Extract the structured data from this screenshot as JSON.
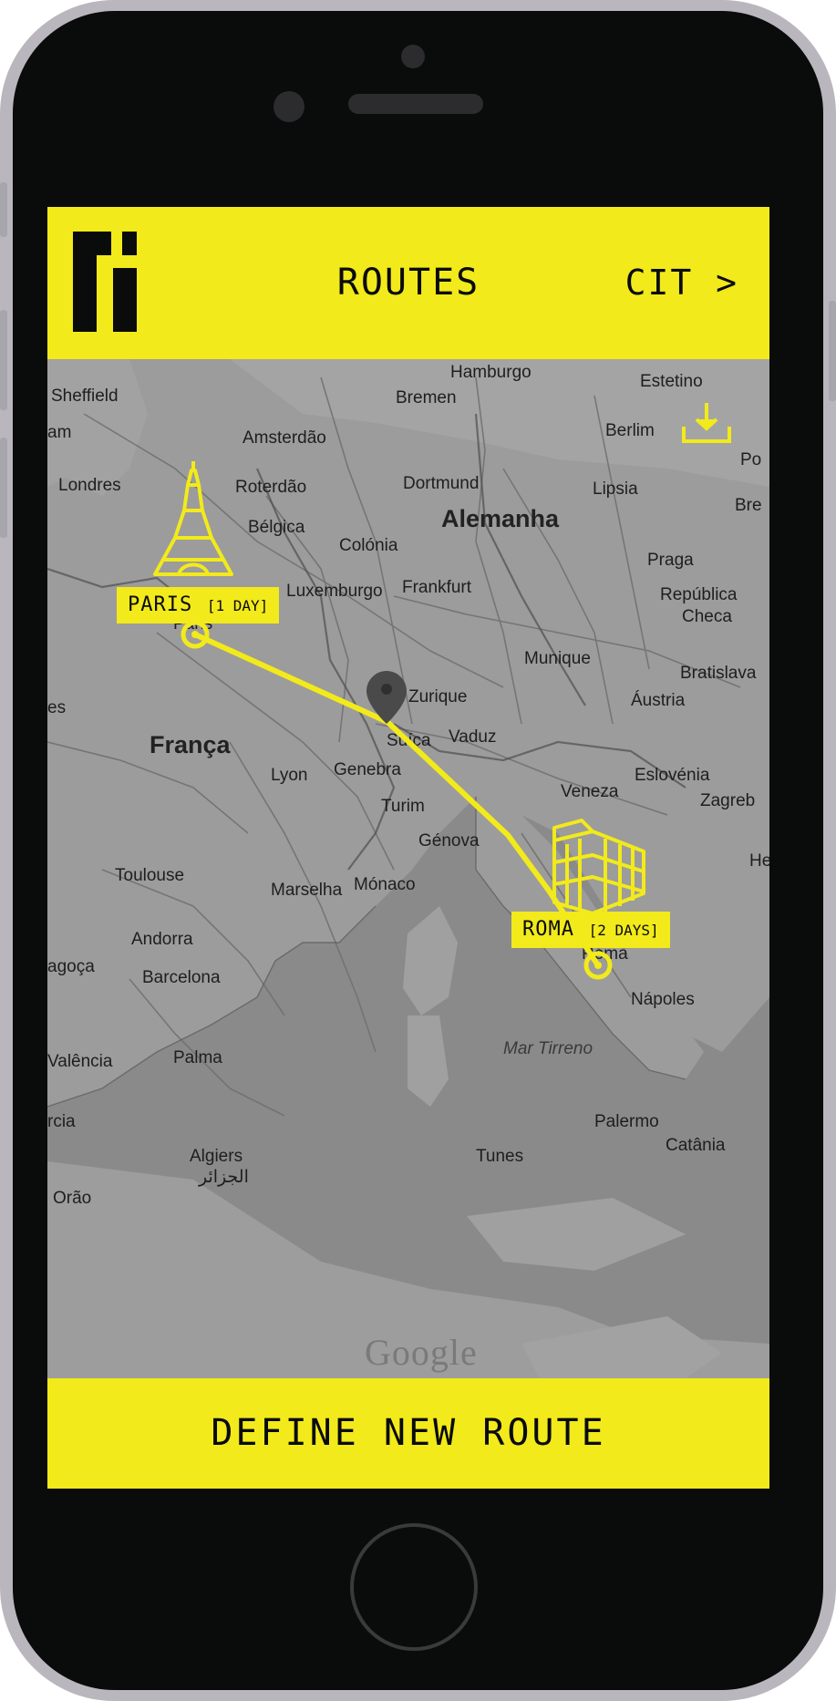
{
  "header": {
    "title": "ROUTES",
    "next_label": "CIT >"
  },
  "map": {
    "labels": {
      "hamburgo": "Hamburgo",
      "bremen": "Bremen",
      "estetino": "Estetino",
      "berlim": "Berlim",
      "sheffield": "Sheffield",
      "am": "am",
      "amsterdao": "Amsterdão",
      "londres": "Londres",
      "roterdao": "Roterdão",
      "dortmund": "Dortmund",
      "lipsia": "Lipsia",
      "po": "Po",
      "bre": "Bre",
      "belgica": "Bélgica",
      "alemanha": "Alemanha",
      "colonia": "Colónia",
      "praga": "Praga",
      "luxemburgo": "Luxemburgo",
      "frankfurt": "Frankfurt",
      "republica": "República",
      "checa": "Checa",
      "paris": "Paris",
      "munique": "Munique",
      "bratislava": "Bratislava",
      "zurique": "Zurique",
      "austria": "Áustria",
      "vaduz": "Vaduz",
      "es": "es",
      "franca": "França",
      "suica": "Suíça",
      "lyon": "Lyon",
      "genebra": "Genebra",
      "eslovenia": "Eslovénia",
      "veneza": "Veneza",
      "zagreb": "Zagreb",
      "turim": "Turim",
      "genova": "Génova",
      "toulouse": "Toulouse",
      "marselha": "Marselha",
      "monaco": "Mónaco",
      "he": "He",
      "andorra": "Andorra",
      "agoca": "agoça",
      "barcelona": "Barcelona",
      "roma": "Roma",
      "napoles": "Nápoles",
      "mar_tirreno": "Mar Tirreno",
      "valencia": "Valência",
      "palma": "Palma",
      "palermo": "Palermo",
      "catania": "Catânia",
      "rcia": "rcia",
      "argel": "Algiers",
      "argel_ar": "الجزائر",
      "tunes": "Tunes",
      "orao": "Orão"
    },
    "credit": "Google",
    "marker_icon": "map-pin-icon",
    "download_icon": "download-icon"
  },
  "route": {
    "color": "#f2ea1b",
    "stops": [
      {
        "name": "PARIS",
        "duration": "[1 DAY]",
        "icon": "eiffel-tower-icon"
      },
      {
        "name": "ROMA",
        "duration": "[2 DAYS]",
        "icon": "colosseum-icon"
      }
    ]
  },
  "footer": {
    "action_label": "DEFINE NEW ROUTE"
  }
}
